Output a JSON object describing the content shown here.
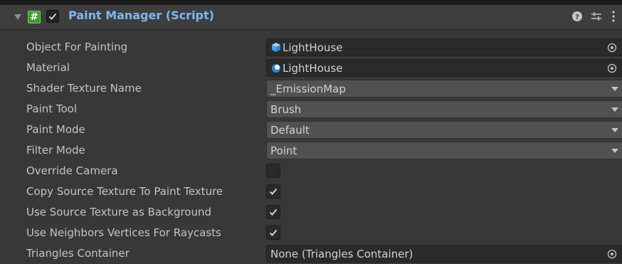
{
  "component": {
    "title": "Paint Manager (Script)",
    "enabled": true,
    "icons": [
      "foldout-arrow-icon",
      "script-icon",
      "help-icon",
      "presets-icon",
      "more-menu-icon"
    ]
  },
  "fields": [
    {
      "label": "Object For Painting",
      "type": "object",
      "value": "LightHouse",
      "icon": "mesh-cube-icon"
    },
    {
      "label": "Material",
      "type": "object",
      "value": "LightHouse",
      "icon": "material-sphere-icon"
    },
    {
      "label": "Shader Texture Name",
      "type": "dropdown",
      "value": "_EmissionMap"
    },
    {
      "label": "Paint Tool",
      "type": "dropdown",
      "value": "Brush"
    },
    {
      "label": "Paint Mode",
      "type": "dropdown",
      "value": "Default"
    },
    {
      "label": "Filter Mode",
      "type": "dropdown",
      "value": "Point"
    },
    {
      "label": "Override Camera",
      "type": "toggle",
      "checked": false
    },
    {
      "label": "Copy Source Texture To Paint Texture",
      "type": "toggle",
      "checked": true
    },
    {
      "label": "Use Source Texture as Background",
      "type": "toggle",
      "checked": true
    },
    {
      "label": "Use Neighbors Vertices For Raycasts",
      "type": "toggle",
      "checked": true
    },
    {
      "label": "Triangles Container",
      "type": "object",
      "value": "None (Triangles Container)"
    }
  ],
  "colors": {
    "background": "#383838",
    "header": "#3e3e3e",
    "title": "#7fb8f5",
    "text": "#c4c4c4",
    "field": "#2a2a2a",
    "dropdown": "#515151",
    "script_icon": "#3e9a35"
  }
}
